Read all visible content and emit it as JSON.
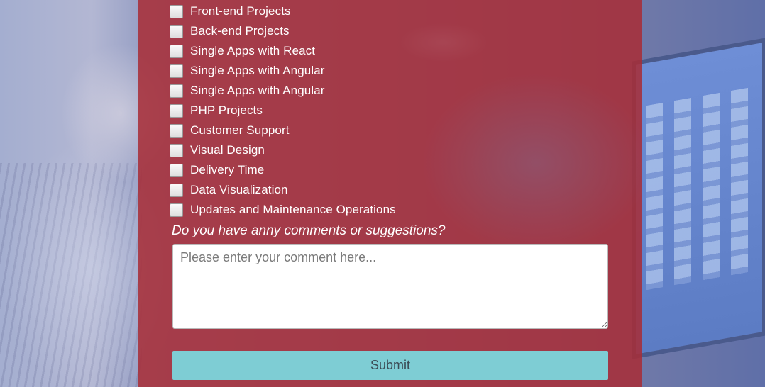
{
  "form": {
    "options": [
      {
        "label": "Front-end Projects",
        "checked": false
      },
      {
        "label": "Back-end Projects",
        "checked": false
      },
      {
        "label": "Single Apps with React",
        "checked": false
      },
      {
        "label": "Single Apps with Angular",
        "checked": false
      },
      {
        "label": "Single Apps with Angular",
        "checked": false
      },
      {
        "label": "PHP Projects",
        "checked": false
      },
      {
        "label": "Customer Support",
        "checked": false
      },
      {
        "label": "Visual Design",
        "checked": false
      },
      {
        "label": "Delivery Time",
        "checked": false
      },
      {
        "label": "Data Visualization",
        "checked": false
      },
      {
        "label": "Updates and Maintenance Operations",
        "checked": false
      }
    ],
    "comments_question": "Do you have anny comments or suggestions?",
    "comment_value": "",
    "comment_placeholder": "Please enter your comment here...",
    "submit_label": "Submit"
  },
  "colors": {
    "overlay": "#a82c36",
    "submit_bg": "#7ecdd4",
    "submit_text": "#3b4b55"
  }
}
